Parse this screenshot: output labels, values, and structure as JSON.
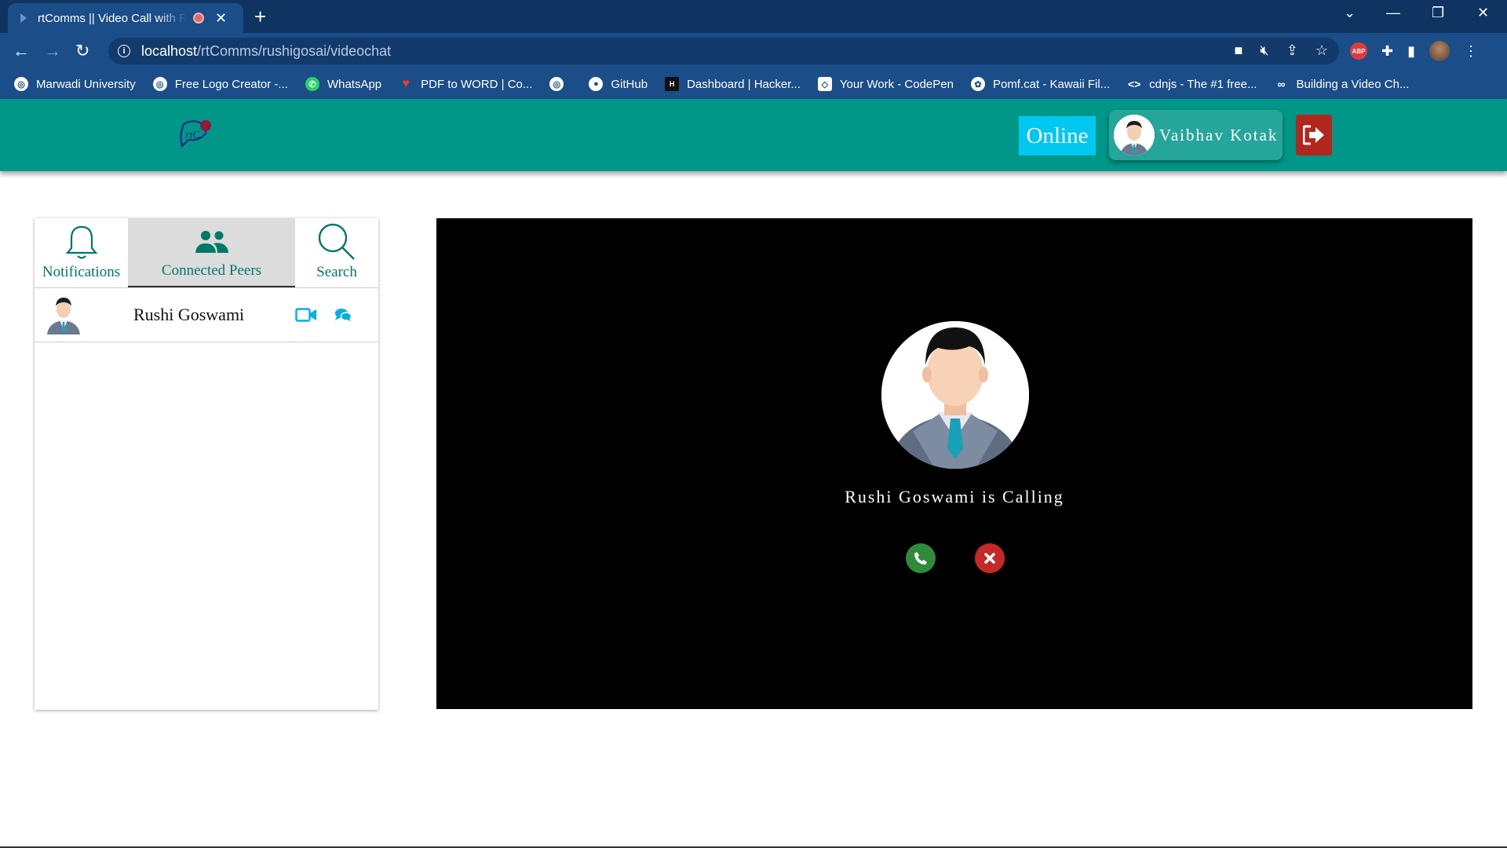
{
  "browser": {
    "tab_title": "rtComms || Video Call with Rushi",
    "url_host": "localhost",
    "url_path": "/rtComms/rushigosai/videochat",
    "bookmarks": [
      {
        "label": "Marwadi University",
        "icon": "globe-icon"
      },
      {
        "label": "Free Logo Creator -...",
        "icon": "globe-icon"
      },
      {
        "label": "WhatsApp",
        "icon": "whatsapp-icon"
      },
      {
        "label": "PDF to WORD | Co...",
        "icon": "heart-icon"
      },
      {
        "label": "",
        "icon": "globe-icon"
      },
      {
        "label": "GitHub",
        "icon": "github-icon"
      },
      {
        "label": "Dashboard | Hacker...",
        "icon": "hackerrank-icon"
      },
      {
        "label": "Your Work - CodePen",
        "icon": "codepen-icon"
      },
      {
        "label": "Pomf.cat - Kawaii Fil...",
        "icon": "cat-icon"
      },
      {
        "label": "cdnjs - The #1 free...",
        "icon": "code-icon"
      },
      {
        "label": "Building a Video Ch...",
        "icon": "link-icon"
      }
    ],
    "abp_label": "ABP"
  },
  "header": {
    "logo_text": "rtC",
    "status": "Online",
    "user_name": "Vaibhav Kotak"
  },
  "panel": {
    "tabs": [
      {
        "label": "Notifications",
        "icon": "bell-icon"
      },
      {
        "label": "Connected Peers",
        "icon": "people-icon"
      },
      {
        "label": "Search",
        "icon": "search-icon"
      }
    ],
    "peers": [
      {
        "name": "Rushi Goswami"
      }
    ]
  },
  "call": {
    "message": "Rushi Goswami is Calling"
  },
  "colors": {
    "header": "#009688",
    "online": "#00c8f0",
    "accept": "#2e8b3a",
    "decline": "#c62828",
    "peer_action": "#00b0e6"
  }
}
